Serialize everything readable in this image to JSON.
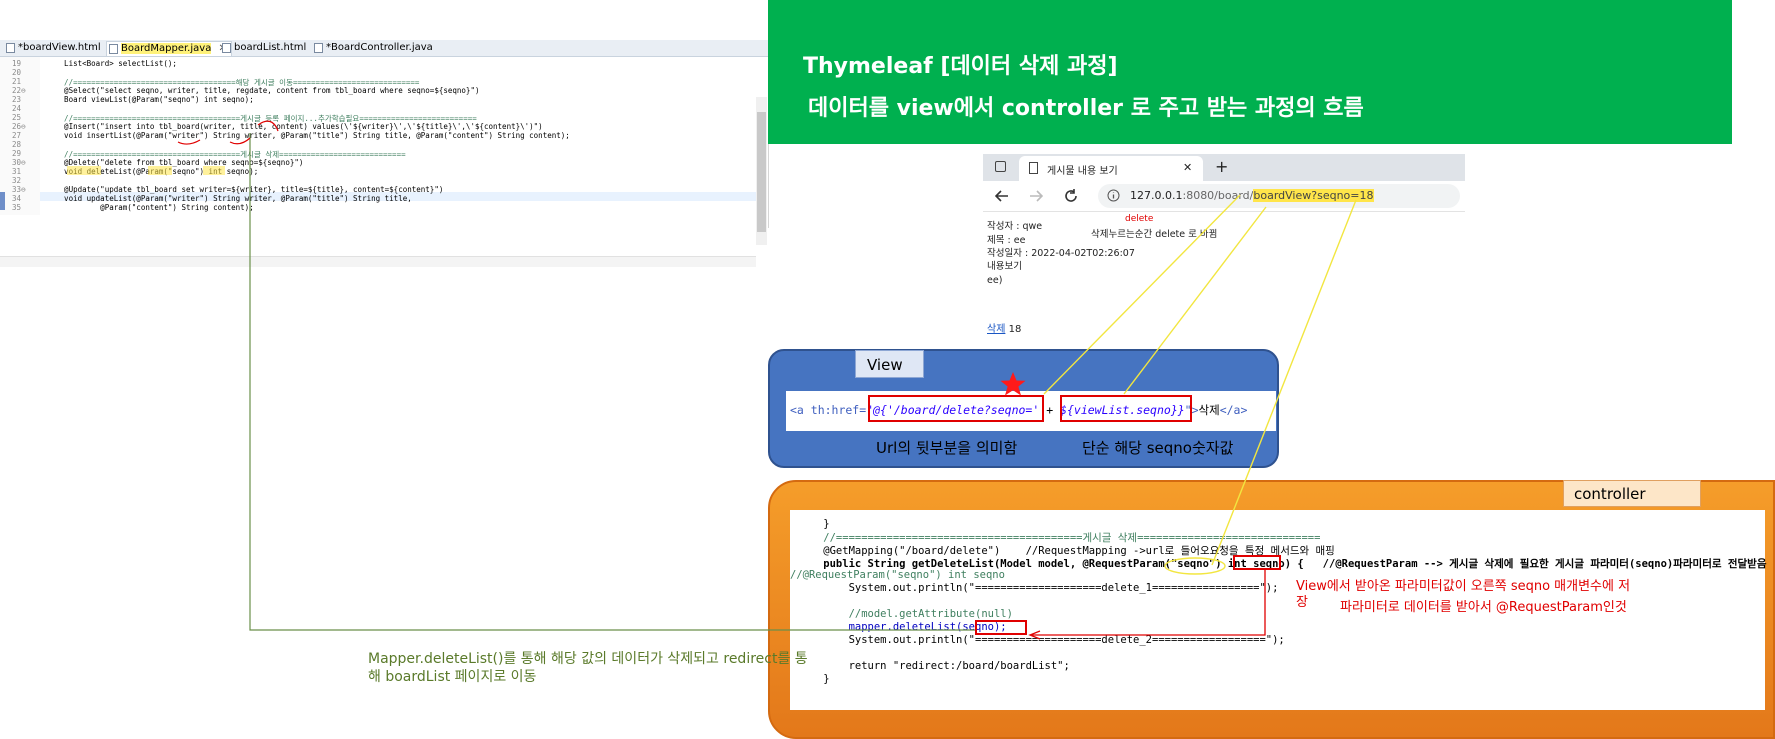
{
  "editor": {
    "tabs": [
      {
        "label": "*boardView.html",
        "active": false
      },
      {
        "label": "BoardMapper.java",
        "active": true
      },
      {
        "label": "boardList.html",
        "active": false
      },
      {
        "label": "*BoardController.java",
        "active": false
      }
    ],
    "close_glyph": "✕",
    "lines": [
      {
        "no": "19",
        "text": "    List<Board> selectList();"
      },
      {
        "no": "20",
        "text": ""
      },
      {
        "no": "21",
        "text": "    //====================================해당 게시글 이동============================"
      },
      {
        "no": "22⊖",
        "text": "    @Select(\"select seqno, writer, title, regdate, content from tbl_board where seqno=${seqno}\")"
      },
      {
        "no": "23",
        "text": "    Board viewList(@Param(\"seqno\") int seqno);"
      },
      {
        "no": "24",
        "text": ""
      },
      {
        "no": "25",
        "text": "    //=====================================게시글 등록 페이지...추가학습필요=========================="
      },
      {
        "no": "26⊖",
        "text": "    @Insert(\"insert into tbl_board(writer, title, content) values(\\'${writer}\\',\\'${title}\\',\\'${content}\\')\")"
      },
      {
        "no": "27",
        "text": "    void insertList(@Param(\"writer\") String writer, @Param(\"title\") String title, @Param(\"content\") String content);"
      },
      {
        "no": "28",
        "text": ""
      },
      {
        "no": "29",
        "text": "    //=====================================게시글 삭제============================"
      },
      {
        "no": "30⊖",
        "text": "    @Delete(\"delete from tbl_board where seqno=${seqno}\")"
      },
      {
        "no": "31",
        "text": "    void deleteList(@Param(\"seqno\") int seqno);"
      },
      {
        "no": "32",
        "text": ""
      },
      {
        "no": "33⊖",
        "text": "    @Update(\"update tbl_board set writer=${writer}, title=${title}, content=${content}\")"
      },
      {
        "no": "34",
        "text": "    void updateList(@Param(\"writer\") String writer, @Param(\"title\") String title,"
      },
      {
        "no": "35",
        "text": "            @Param(\"content\") String content);"
      }
    ]
  },
  "header": {
    "line1": "Thymeleaf  [데이터 삭제 과정]",
    "line2": "데이터를 view에서 controller 로 주고 받는 과정의 흐름"
  },
  "browser": {
    "tab_title": "게시물 내용 보기",
    "new_tab": "+",
    "url_host": "127.0.0.1",
    "url_rest": ":8080/board/",
    "url_path": "boardView",
    "url_query": "?seqno=18",
    "delete_note": "delete",
    "page_note": "삭제누르는순간  delete 로 바뀜",
    "writer": "작성자 : qwe",
    "title": "제목 : ee",
    "date": "작성일자 : 2022-04-02T02:26:07",
    "content_label": "내용보기",
    "content": "ee)",
    "delete_link": "삭제",
    "delete_num": " 18"
  },
  "view": {
    "tab": "View",
    "code_prefix": "<a th:href=",
    "code_url": "\"@{'/board/delete?seqno='",
    "code_plus": " + ",
    "code_expr": "${viewList.seqno}}",
    "code_suffix_q": "\">",
    "code_text": "삭제",
    "code_end": "</a>",
    "label_url": "Url의 뒷부분을 의미함",
    "label_seqno": "단순 해당 seqno숫자값"
  },
  "controller": {
    "tab": "controller",
    "lines": [
      "    }",
      "    //=======================================게시글 삭제=============================",
      "    @GetMapping(\"/board/delete\")    //RequestMapping ->url로 들어오요청을 특정 메서드와 매핑",
      "    public String getDeleteList(Model model, @RequestParam(\"seqno\") int seqno) {   //@RequestParam --> 게시글 삭제에 필요한 게시글 파라미터(seqno)파라미터로 전달받음",
      "//@RequestParam(\"seqno\") int seqno",
      "        System.out.println(\"====================delete_1=================\");",
      "",
      "        //model.getAttribute(null)",
      "        mapper.deleteList(seqno);",
      "        System.out.println(\"====================delete_2==================\");",
      "",
      "        return \"redirect:/board/boardList\";",
      "    }"
    ],
    "note_line1": "View에서 받아온 파라미터값이 오른쪽 seqno 매개변수에 저",
    "note_line1b": "장",
    "note_line2": "파라미터로 데이터를 받아서 @RequestParam인것"
  },
  "mapper_note": {
    "line1": "Mapper.deleteList()를 통해 해당 값의 데이터가 삭제되고  redirect를 통",
    "line2": "해 boardList 페이지로 이동"
  },
  "colors": {
    "header_green": "#00b04f",
    "view_blue": "#4674c1",
    "controller_orange": "#f0902a",
    "highlight": "#ffe54a",
    "red": "#e00000"
  }
}
